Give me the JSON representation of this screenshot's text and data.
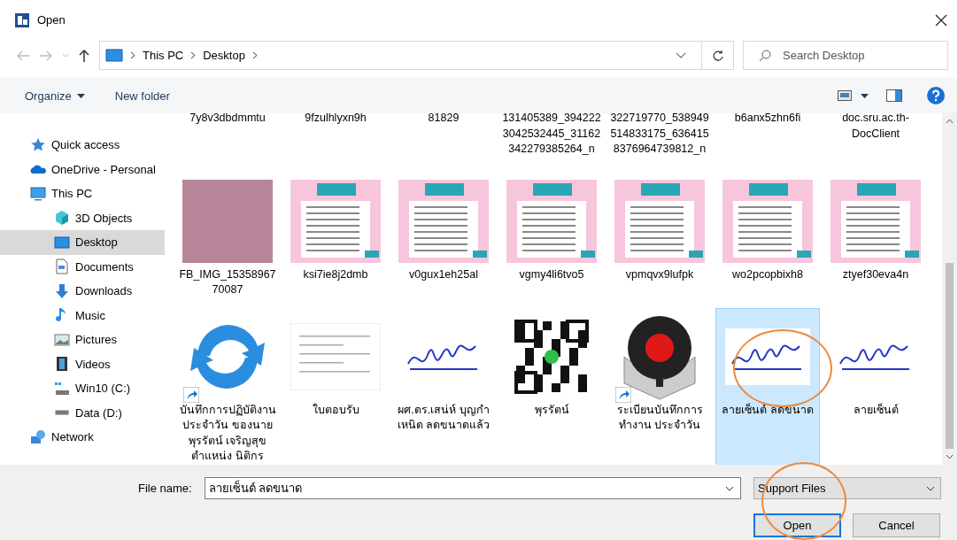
{
  "window": {
    "title": "Open"
  },
  "address": {
    "path": [
      "This PC",
      "Desktop"
    ]
  },
  "search": {
    "placeholder": "Search Desktop"
  },
  "toolbar": {
    "organize": "Organize",
    "new_folder": "New folder"
  },
  "sidebar": {
    "items": [
      {
        "label": "Quick access",
        "kind": "star",
        "selected": false
      },
      {
        "label": "OneDrive - Personal",
        "kind": "cloud",
        "selected": false
      },
      {
        "label": "This PC",
        "kind": "pc",
        "selected": false,
        "children": [
          {
            "label": "3D Objects",
            "kind": "cube",
            "selected": false
          },
          {
            "label": "Desktop",
            "kind": "desktop",
            "selected": true
          },
          {
            "label": "Documents",
            "kind": "document",
            "selected": false
          },
          {
            "label": "Downloads",
            "kind": "download",
            "selected": false
          },
          {
            "label": "Music",
            "kind": "music",
            "selected": false
          },
          {
            "label": "Pictures",
            "kind": "picture",
            "selected": false
          },
          {
            "label": "Videos",
            "kind": "video",
            "selected": false
          },
          {
            "label": "Win10 (C:)",
            "kind": "system-drive",
            "selected": false
          },
          {
            "label": "Data (D:)",
            "kind": "drive",
            "selected": false
          }
        ]
      },
      {
        "label": "Network",
        "kind": "network",
        "selected": false
      }
    ]
  },
  "files": {
    "rows": [
      [
        {
          "name": "7y8v3dbdmmtu",
          "kind": "none",
          "shortcut": false,
          "selected": false
        },
        {
          "name": "9fzulhlyxn9h",
          "kind": "none",
          "shortcut": false,
          "selected": false
        },
        {
          "name": "81829",
          "kind": "none",
          "shortcut": false,
          "selected": false
        },
        {
          "name": "131405389_3942223042532445_31162342279385264_n",
          "kind": "none",
          "shortcut": false,
          "selected": false
        },
        {
          "name": "322719770_538949514833175_6364158376964739812_n",
          "kind": "none",
          "shortcut": false,
          "selected": false
        },
        {
          "name": "b6anx5zhn6fi",
          "kind": "none",
          "shortcut": false,
          "selected": false
        },
        {
          "name": "doc.sru.ac.th-DocClient",
          "kind": "none",
          "shortcut": false,
          "selected": false
        }
      ],
      [
        {
          "name": "FB_IMG_1535896770087",
          "kind": "photo",
          "shortcut": false,
          "selected": false
        },
        {
          "name": "ksi7ie8j2dmb",
          "kind": "cheatsheet",
          "shortcut": false,
          "selected": false
        },
        {
          "name": "v0gux1eh25al",
          "kind": "cheatsheet",
          "shortcut": false,
          "selected": false
        },
        {
          "name": "vgmy4li6tvo5",
          "kind": "cheatsheet",
          "shortcut": false,
          "selected": false
        },
        {
          "name": "vpmqvx9lufpk",
          "kind": "cheatsheet",
          "shortcut": false,
          "selected": false
        },
        {
          "name": "wo2pcopbixh8",
          "kind": "cheatsheet",
          "shortcut": false,
          "selected": false
        },
        {
          "name": "ztyef30eva4n",
          "kind": "cheatsheet",
          "shortcut": false,
          "selected": false
        }
      ],
      [
        {
          "name": "บันทึกการปฏิบัติงานประจำวัน ของนายพุรรัตน์  เจริญสุข ตำแหน่ง นิติกร",
          "kind": "sync",
          "shortcut": true,
          "selected": false
        },
        {
          "name": "ใบตอบรับ",
          "kind": "form",
          "shortcut": false,
          "selected": false
        },
        {
          "name": "ผศ.ดร.เสน่ห์  บุญกำเหนิด ลดขนาดแล้ว",
          "kind": "signature",
          "shortcut": false,
          "selected": false
        },
        {
          "name": "พุรรัตน์",
          "kind": "qr",
          "shortcut": false,
          "selected": false
        },
        {
          "name": "ระเบียนบันทึกการทำงาน ประจำวัน",
          "kind": "record",
          "shortcut": true,
          "selected": false
        },
        {
          "name": "ลายเซ็นต์ ลดขนาด",
          "kind": "signature",
          "shortcut": false,
          "selected": true
        },
        {
          "name": "ลายเซ็นต์",
          "kind": "signature",
          "shortcut": false,
          "selected": false
        }
      ]
    ]
  },
  "file_name": {
    "label": "File name:",
    "value": "ลายเซ็นต์ ลดขนาด"
  },
  "file_type": {
    "value": "Support Files"
  },
  "buttons": {
    "open": "Open",
    "cancel": "Cancel"
  }
}
